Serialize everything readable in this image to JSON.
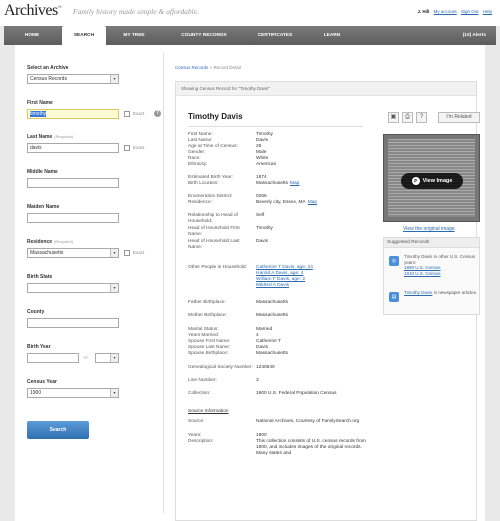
{
  "brand": {
    "logo": "Archives",
    "tagline": "Family history made simple & affordable."
  },
  "user": {
    "name": "J. Hill",
    "my_account": "My account",
    "sign_out": "Sign Out",
    "help": "Help"
  },
  "nav": {
    "tabs": [
      "HOME",
      "SEARCH",
      "MY TREE",
      "COUNTY RECORDS",
      "CERTIFICATES",
      "LEARN"
    ],
    "active": "SEARCH",
    "alerts": "(10) Alerts"
  },
  "sidebar": {
    "archive_label": "Select an Archive",
    "archive_value": "Census Records",
    "first_name_label": "First Name",
    "first_name_value": "timothy",
    "last_name_label": "Last Name",
    "required": "(Required)",
    "last_name_value": "davis",
    "middle_name_label": "Middle Name",
    "maiden_name_label": "Maiden Name",
    "residence_label": "Residence",
    "residence_value": "Massachusetts",
    "birth_state_label": "Birth State",
    "county_label": "County",
    "birth_year_label": "Birth Year",
    "plus_minus": "+/-",
    "census_year_label": "Census Year",
    "census_year_value": "1900",
    "exact": "Exact",
    "search_button": "Search"
  },
  "breadcrumb": {
    "link": "Census Records",
    "sep": ">",
    "current": "Record Detail"
  },
  "record": {
    "header": "Showing Census Record for \"Timothy Davis\"",
    "name": "Timothy Davis",
    "related_button": "I'm Related",
    "fields": [
      {
        "k": "First Name:",
        "v": "Timothy"
      },
      {
        "k": "Last Name:",
        "v": "Davis"
      },
      {
        "k": "Age at Time of Census:",
        "v": "26"
      },
      {
        "k": "Gender:",
        "v": "Male"
      },
      {
        "k": "Race:",
        "v": "White"
      },
      {
        "k": "Ethnicity:",
        "v": "American"
      },
      {
        "k": "Estimated Birth Year:",
        "v": "1874"
      },
      {
        "k": "Birth Location:",
        "v": "Massachusetts",
        "link": "Map"
      },
      {
        "k": "Enumeration District:",
        "v": "0266"
      },
      {
        "k": "Residence:",
        "v": "Beverly city, Essex, MA",
        "link": "Map"
      },
      {
        "k": "Relationship to Head of Household:",
        "v": "Self"
      },
      {
        "k": "Head of Household First Name:",
        "v": "Timothy"
      },
      {
        "k": "Head of Household Last Name:",
        "v": "Davis"
      },
      {
        "k": "Other People in Household:",
        "people": [
          "Catherine T Davis, age: 24",
          "Harold A Davis, age: 4",
          "William F Davis, age: 2",
          "Mildred A Davis"
        ]
      },
      {
        "k": "Father Birthplace:",
        "v": "Massachusetts"
      },
      {
        "k": "Mother Birthplace:",
        "v": "Massachusetts"
      },
      {
        "k": "Marital Status:",
        "v": "Married"
      },
      {
        "k": "Years Married:",
        "v": "4"
      },
      {
        "k": "Spouse First Name:",
        "v": "Catherine T"
      },
      {
        "k": "Spouse Last Name:",
        "v": "Davis"
      },
      {
        "k": "Spouse Birthplace:",
        "v": "Massachusetts"
      },
      {
        "k": "Genealogical Society Number:",
        "v": "1240640"
      },
      {
        "k": "Line Number:",
        "v": "3"
      },
      {
        "k": "Collection:",
        "v": "1900 U.S. Federal Population Census"
      }
    ],
    "source_heading": "Source Information",
    "source": [
      {
        "k": "Source:",
        "v": "National Archives, Courtesy of FamilySearch.org"
      },
      {
        "k": "Years:",
        "v": "1900"
      },
      {
        "k": "Description:",
        "v": "This collection consists of U.S. census records from 1900, and includes images of the original records. Many states and"
      }
    ]
  },
  "image_panel": {
    "view_button": "View Image",
    "view_original": "View the original image"
  },
  "suggested": {
    "title": "Suggested Records",
    "census_text": "Timothy Davis in other U.S. Census years:",
    "census_links": [
      "1890 U.S. Census",
      "1910 U.S. Census"
    ],
    "news_link": "Timothy Davis",
    "news_text": "in newspaper articles."
  }
}
